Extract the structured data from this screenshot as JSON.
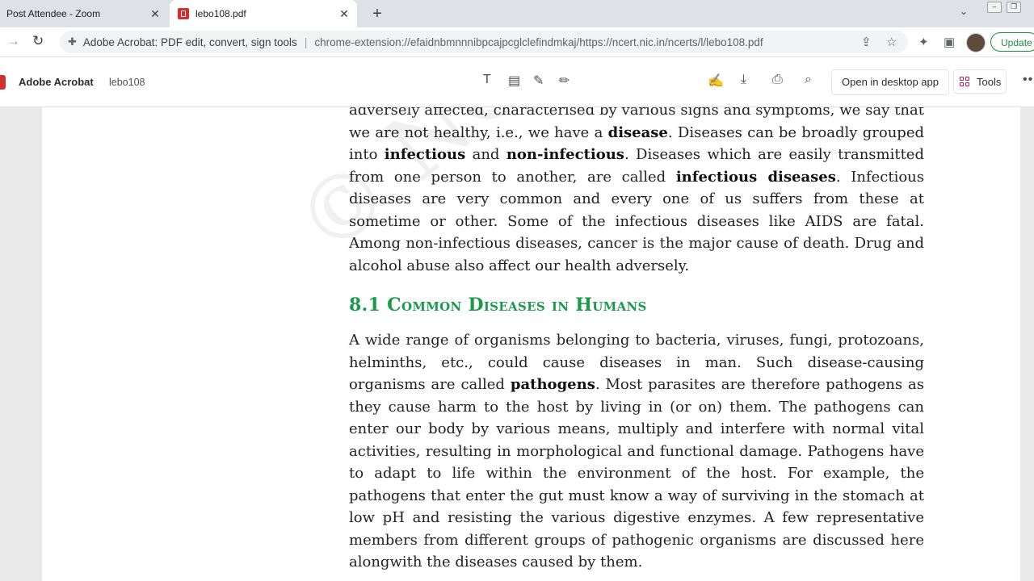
{
  "browser": {
    "tabs": [
      {
        "title": "Post Attendee - Zoom",
        "active": false
      },
      {
        "title": "lebo108.pdf",
        "active": true
      }
    ],
    "new_tab_label": "+",
    "address": {
      "site_label": "Adobe Acrobat: PDF edit, convert, sign tools",
      "url": "chrome-extension://efaidnbmnnnibpcajpcglclefindmkaj/https://ncert.nic.in/ncerts/l/lebo108.pdf"
    },
    "update_label": "Update"
  },
  "acrobat": {
    "app_name": "Adobe Acrobat",
    "file_name": "lebo108",
    "open_desktop_label": "Open in desktop app",
    "tools_label": "Tools"
  },
  "document": {
    "para1": [
      {
        "t": "adversely affected, characterised by various signs and symptoms, we say that we are not healthy, i.e., we have a "
      },
      {
        "b": "disease"
      },
      {
        "t": ". Diseases can be broadly grouped into "
      },
      {
        "b": "infectious"
      },
      {
        "t": " and "
      },
      {
        "b": "non-infectious"
      },
      {
        "t": ". Diseases which are easily transmitted from one person to another, are called "
      },
      {
        "b": "infectious diseases"
      },
      {
        "t": ". Infectious diseases are very common and every one of us suffers from these at sometime or other. Some of the infectious diseases like AIDS are fatal. Among non-infectious diseases, cancer is the major cause of death. Drug and alcohol abuse also affect our health adversely."
      }
    ],
    "heading_num": "8.1",
    "heading_text": "Common Diseases in Humans",
    "para2": [
      {
        "t": "A wide range of organisms belonging to bacteria, viruses, fungi, protozoans, helminths, etc., could cause diseases in man. Such disease-causing organisms are called "
      },
      {
        "b": "pathogens"
      },
      {
        "t": ". Most parasites are therefore pathogens as they cause harm to the host by living in (or on) them. The pathogens can enter our body by various means, multiply and interfere with normal vital activities, resulting in morphological and functional damage. Pathogens have to adapt to life within the environment of the host. For example, the pathogens that enter the gut must know a way of surviving in the stomach at low pH and resisting the various digestive enzymes. A few representative members from different groups of pathogenic organisms are discussed here alongwith the diseases caused by them."
      }
    ]
  }
}
